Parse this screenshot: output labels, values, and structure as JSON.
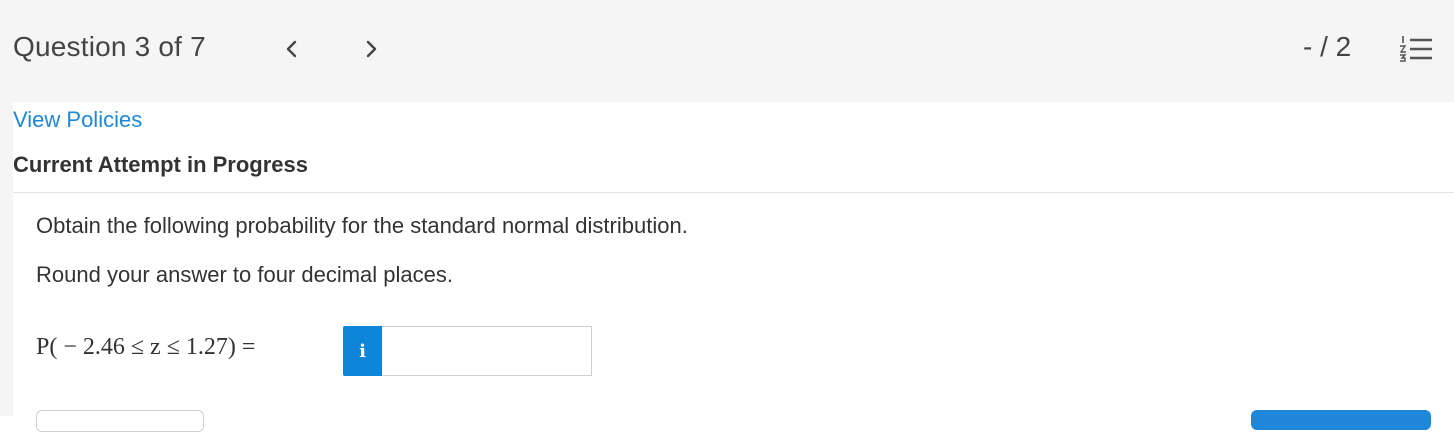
{
  "header": {
    "question_label": "Question 3 of 7",
    "prev_icon": "chevron-left-icon",
    "next_icon": "chevron-right-icon",
    "score": "- / 2",
    "list_icon": "numbered-list-icon"
  },
  "links": {
    "view_policies": "View Policies"
  },
  "attempt": {
    "status": "Current Attempt in Progress"
  },
  "question": {
    "prompt": "Obtain the following probability for the standard normal distribution.",
    "instruction": "Round your answer to four decimal places.",
    "equation": "P( − 2.46 ≤ z ≤ 1.27) =",
    "info_label": "i",
    "answer_value": "",
    "answer_placeholder": ""
  },
  "colors": {
    "accent": "#1f87d8",
    "info_button": "#0f85d9",
    "topbar_bg": "#f5f5f5"
  }
}
